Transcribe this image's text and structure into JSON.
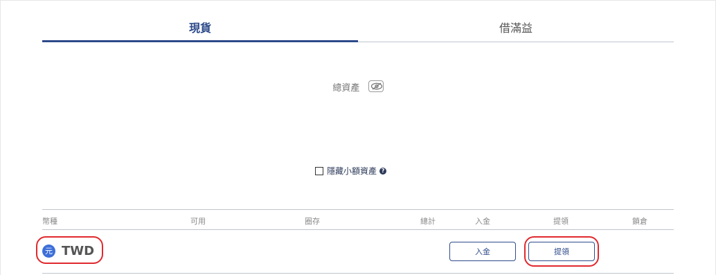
{
  "tabs": [
    {
      "label": "現貨",
      "active": true
    },
    {
      "label": "借滿益",
      "active": false
    }
  ],
  "total_assets": {
    "label": "總資產",
    "icon": "eye-icon"
  },
  "hide_small": {
    "label": "隱藏小額資產",
    "checked": false,
    "help_icon": "question-circle-icon"
  },
  "table": {
    "columns": [
      "幣種",
      "可用",
      "圈存",
      "總計",
      "入金",
      "提領",
      "鎖倉"
    ],
    "rows": [
      {
        "currency_icon_text": "元",
        "currency": "TWD",
        "deposit_label": "入金",
        "withdraw_label": "提領"
      }
    ]
  },
  "colors": {
    "accent": "#2d4a8a",
    "annotation": "#e0282d",
    "coin": "#3d6fd9"
  }
}
